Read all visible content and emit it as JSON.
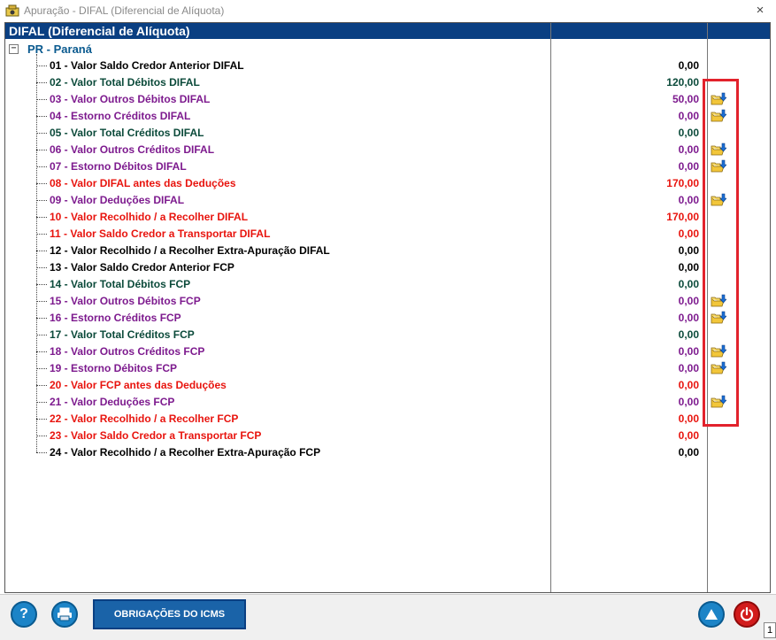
{
  "window": {
    "title": "Apuração - DIFAL (Diferencial de Alíquota)",
    "close_symbol": "×"
  },
  "header": {
    "title": "DIFAL (Diferencial de Alíquota)"
  },
  "group": {
    "expand_symbol": "−",
    "label": "PR - Paraná"
  },
  "rows": [
    {
      "label": "01 - Valor Saldo Credor Anterior DIFAL",
      "value": "0,00",
      "color": "black",
      "folder": false
    },
    {
      "label": "02 - Valor Total Débitos DIFAL",
      "value": "120,00",
      "color": "green",
      "folder": false
    },
    {
      "label": "03 - Valor Outros Débitos DIFAL",
      "value": "50,00",
      "color": "purple",
      "folder": true
    },
    {
      "label": "04 - Estorno Créditos DIFAL",
      "value": "0,00",
      "color": "purple",
      "folder": true
    },
    {
      "label": "05 - Valor Total Créditos DIFAL",
      "value": "0,00",
      "color": "green",
      "folder": false
    },
    {
      "label": "06 - Valor Outros Créditos DIFAL",
      "value": "0,00",
      "color": "purple",
      "folder": true
    },
    {
      "label": "07 - Estorno Débitos DIFAL",
      "value": "0,00",
      "color": "purple",
      "folder": true
    },
    {
      "label": "08 - Valor DIFAL antes das Deduções",
      "value": "170,00",
      "color": "red",
      "folder": false
    },
    {
      "label": "09 - Valor Deduções DIFAL",
      "value": "0,00",
      "color": "purple",
      "folder": true
    },
    {
      "label": "10 - Valor Recolhido / a Recolher DIFAL",
      "value": "170,00",
      "color": "red",
      "folder": false
    },
    {
      "label": "11 - Valor Saldo Credor a Transportar DIFAL",
      "value": "0,00",
      "color": "red",
      "folder": false
    },
    {
      "label": "12 - Valor Recolhido / a Recolher Extra-Apuração DIFAL",
      "value": "0,00",
      "color": "black",
      "folder": false
    },
    {
      "label": "13 - Valor Saldo Credor Anterior FCP",
      "value": "0,00",
      "color": "black",
      "folder": false
    },
    {
      "label": "14 - Valor Total Débitos FCP",
      "value": "0,00",
      "color": "green",
      "folder": false
    },
    {
      "label": "15 - Valor Outros Débitos FCP",
      "value": "0,00",
      "color": "purple",
      "folder": true
    },
    {
      "label": "16 - Estorno Créditos FCP",
      "value": "0,00",
      "color": "purple",
      "folder": true
    },
    {
      "label": "17 - Valor Total Créditos FCP",
      "value": "0,00",
      "color": "green",
      "folder": false
    },
    {
      "label": "18 - Valor Outros Créditos FCP",
      "value": "0,00",
      "color": "purple",
      "folder": true
    },
    {
      "label": "19 - Estorno Débitos FCP",
      "value": "0,00",
      "color": "purple",
      "folder": true
    },
    {
      "label": "20 - Valor FCP antes das Deduções",
      "value": "0,00",
      "color": "red",
      "folder": false
    },
    {
      "label": "21 - Valor Deduções FCP",
      "value": "0,00",
      "color": "purple",
      "folder": true
    },
    {
      "label": "22 - Valor Recolhido / a Recolher FCP",
      "value": "0,00",
      "color": "red",
      "folder": false
    },
    {
      "label": "23 - Valor Saldo Credor a Transportar FCP",
      "value": "0,00",
      "color": "red",
      "folder": false
    },
    {
      "label": "24 - Valor Recolhido / a Recolher Extra-Apuração FCP",
      "value": "0,00",
      "color": "black",
      "folder": false
    }
  ],
  "colors": {
    "header_bg": "#0a3f82",
    "green": "#0b4a3a",
    "purple": "#7d1a8e",
    "red": "#e8140e",
    "highlight": "#e2222c"
  },
  "icons": {
    "folder": "folder-arrow-icon",
    "help": "help-icon",
    "print": "printer-icon",
    "up": "arrow-up-icon",
    "power": "power-icon"
  },
  "toolbar": {
    "help_symbol": "?",
    "obrigacoes_label": "OBRIGAÇÕES DO ICMS"
  },
  "corner": {
    "number": "1"
  }
}
